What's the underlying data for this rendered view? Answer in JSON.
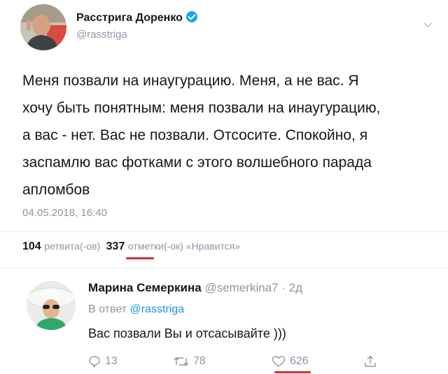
{
  "tweet": {
    "author_name": "Расстрига Доренко",
    "author_handle": "@rasstriga",
    "text_lines": [
      "Меня позвали на инаугурацию. Меня, а не вас. Я",
      "хочу быть понятным: меня позвали на инаугурацию,",
      "а вас - нет. Вас не позвали. Отсосите. Спокойно, я",
      "заспамлю вас фотками с этого волшебного парада",
      "апломбов"
    ],
    "timestamp": "04.05.2018, 16:40",
    "stats": {
      "retweets_count": "104",
      "retweets_label": "ретвита(-ов)",
      "likes_count": "337",
      "likes_label": "отметки(-ок) «Нравится»"
    }
  },
  "reply": {
    "author_name": "Марина Семеркина",
    "author_handle": "@semerkina7",
    "time": "· 2д",
    "reply_to_prefix": "В ответ",
    "reply_to_handle": "@rasstriga",
    "text": "Вас позвали Вы и отсасывайте )))",
    "actions": {
      "reply_count": "13",
      "retweet_count": "78",
      "like_count": "626"
    }
  },
  "colors": {
    "accent": "#1da1f2",
    "annotation": "#d0303c"
  }
}
